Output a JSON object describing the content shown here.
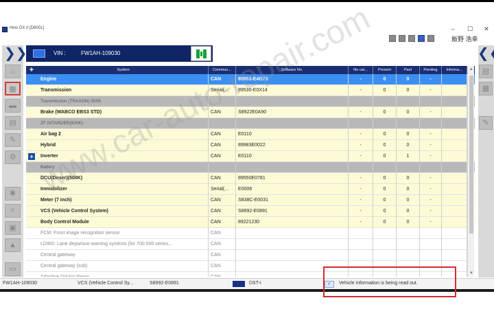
{
  "window": {
    "title": "Hino DX II [D8001]",
    "minimize": "–",
    "maximize": "☐",
    "close": "✕",
    "user": "飯野 浩幸"
  },
  "header": {
    "vin_label": "VIN :",
    "vin_value": "FW1AH-109030"
  },
  "grid": {
    "add_symbol": "+",
    "columns": [
      "System",
      "Commun...",
      "Software No.",
      "No cat...",
      "Present",
      "Past",
      "Pending",
      "Informa..."
    ],
    "rows": [
      {
        "style": "selected",
        "system": "Engine",
        "comm": "CAN",
        "software": "89663-E4G73",
        "nocat": "-",
        "present": "0",
        "past": "0",
        "pending": "-",
        "info": ""
      },
      {
        "style": "yellow",
        "system": "Transmission",
        "comm": "Serial(...",
        "software": "89530-E0X14",
        "nocat": "-",
        "present": "0",
        "past": "0",
        "pending": "-",
        "info": ""
      },
      {
        "style": "group",
        "system": "Transmission (TRAXON) 500K",
        "comm": "",
        "software": "",
        "nocat": "",
        "present": "",
        "past": "",
        "pending": "",
        "info": ""
      },
      {
        "style": "yellow",
        "system": "Brake (WABCO EBS3 STD)",
        "comm": "CAN",
        "software": "S8922E0A90",
        "nocat": "-",
        "present": "0",
        "past": "0",
        "pending": "-",
        "info": ""
      },
      {
        "style": "group",
        "system": "ZF INTARDER(500K)",
        "comm": "",
        "software": "",
        "nocat": "",
        "present": "",
        "past": "",
        "pending": "",
        "info": ""
      },
      {
        "style": "yellow",
        "system": "Air bag 2",
        "comm": "CAN",
        "software": "E0110",
        "nocat": "-",
        "present": "0",
        "past": "0",
        "pending": "-",
        "info": ""
      },
      {
        "style": "yellow",
        "system": "Hybrid",
        "comm": "CAN",
        "software": "89983E0022",
        "nocat": "-",
        "present": "0",
        "past": "0",
        "pending": "-",
        "info": ""
      },
      {
        "style": "yellow",
        "system": "Inverter",
        "comm": "CAN",
        "software": "E0110",
        "nocat": "-",
        "present": "0",
        "past": "1",
        "pending": "-",
        "info": "",
        "expander": "+"
      },
      {
        "style": "group",
        "system": "Battery",
        "comm": "",
        "software": "",
        "nocat": "",
        "present": "",
        "past": "",
        "pending": "",
        "info": ""
      },
      {
        "style": "yellow",
        "system": "DCU(Doser)(500K)",
        "comm": "CAN",
        "software": "89550E0781",
        "nocat": "-",
        "present": "0",
        "past": "0",
        "pending": "-",
        "info": ""
      },
      {
        "style": "yellow",
        "system": "Immobilizer",
        "comm": "Serial(...",
        "software": "E0006",
        "nocat": "-",
        "present": "0",
        "past": "0",
        "pending": "-",
        "info": ""
      },
      {
        "style": "yellow",
        "system": "Meter (7 inch)",
        "comm": "CAN",
        "software": "S838C-E0031",
        "nocat": "-",
        "present": "0",
        "past": "0",
        "pending": "-",
        "info": ""
      },
      {
        "style": "yellow",
        "system": "VCS (Vehicle Control System)",
        "comm": "CAN",
        "software": "S8992-E0891",
        "nocat": "-",
        "present": "0",
        "past": "0",
        "pending": "-",
        "info": ""
      },
      {
        "style": "yellow",
        "system": "Body Control Module",
        "comm": "CAN",
        "software": "89221230",
        "nocat": "-",
        "present": "0",
        "past": "0",
        "pending": "-",
        "info": ""
      },
      {
        "style": "white",
        "system": "FCM: Front image recognition sensor",
        "comm": "CAN",
        "software": "",
        "nocat": "",
        "present": "",
        "past": "",
        "pending": "",
        "info": ""
      },
      {
        "style": "white",
        "system": "LDWS: Lane departure warning systems (for 700 500 series...",
        "comm": "CAN",
        "software": "",
        "nocat": "",
        "present": "",
        "past": "",
        "pending": "",
        "info": ""
      },
      {
        "style": "white",
        "system": "Central gateway",
        "comm": "CAN",
        "software": "",
        "nocat": "",
        "present": "",
        "past": "",
        "pending": "",
        "info": ""
      },
      {
        "style": "white",
        "system": "Central gateway (sub)",
        "comm": "CAN",
        "software": "",
        "nocat": "",
        "present": "",
        "past": "",
        "pending": "",
        "info": ""
      },
      {
        "style": "white",
        "system": "Adaptive Driving Beam",
        "comm": "CAN",
        "software": "",
        "nocat": "",
        "present": "",
        "past": "",
        "pending": "",
        "info": ""
      }
    ]
  },
  "statusbar": {
    "vin": "FW1AH-109030",
    "system": "VCS (Vehicle Control Sy...",
    "software": "S8992-E0891",
    "device": "DST-i",
    "message": "Vehicle information is being read out."
  },
  "watermark": "www.car-auto-repair.com",
  "icons": {
    "left_rail": [
      "home-icon",
      "vehicle-select-icon",
      "truck-icon",
      "ecu-icon",
      "wrench-icon",
      "gear-icon",
      "star-icon",
      "tool-icon",
      "lock-icon",
      "up-icon",
      "print-icon"
    ],
    "right_rail": [
      "ecu-icon",
      "ecu-icon",
      "dtc-icon"
    ]
  },
  "colors": {
    "header_bg": "#0f2566",
    "selected_row": "#3c8ff2",
    "highlight_row": "#fdfbd6",
    "group_row": "#b8b8b8",
    "connection_icon": "#16a03a",
    "callout_border": "#d32b2b"
  }
}
